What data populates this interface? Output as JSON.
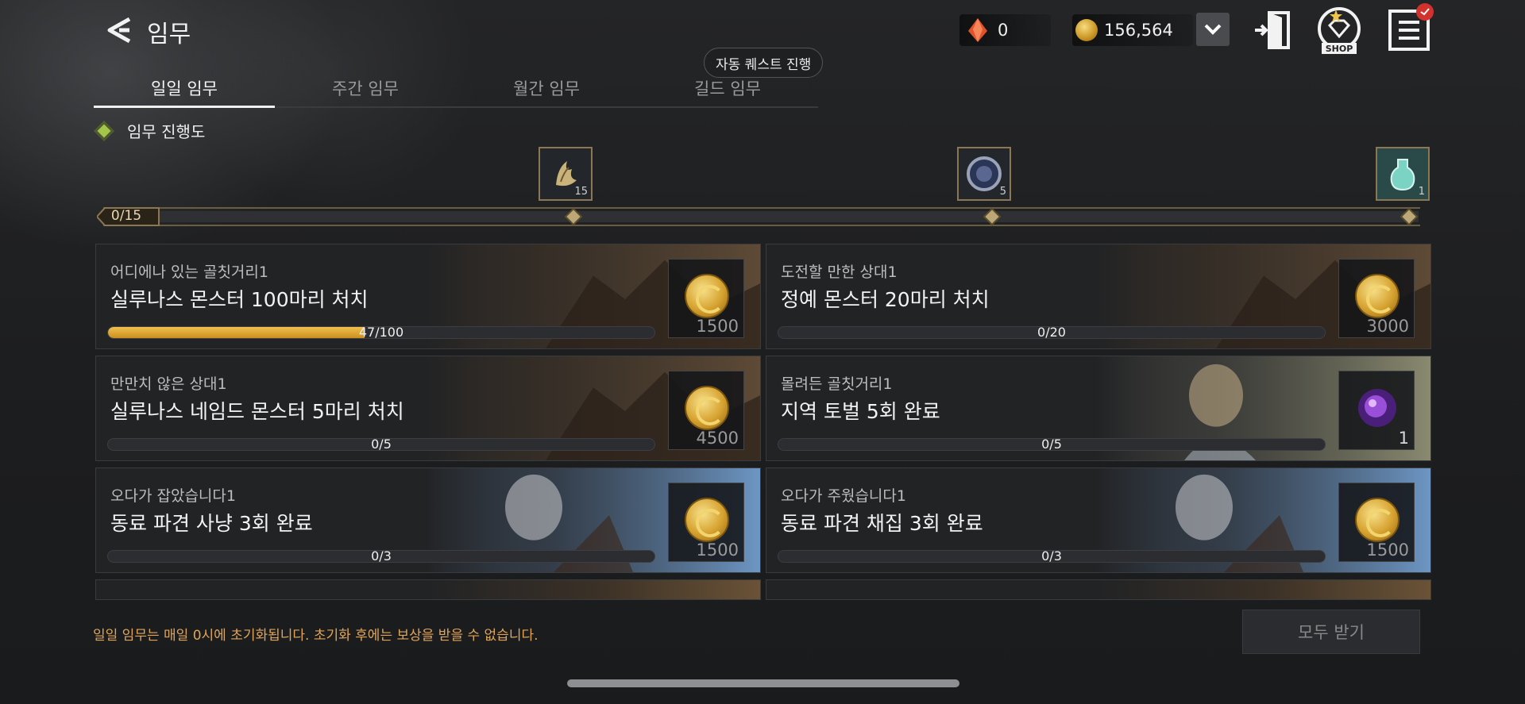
{
  "header": {
    "title": "임무",
    "back_icon": "back-arrow-icon"
  },
  "currency": {
    "gem_count": "0",
    "gold_count": "156,564",
    "gem_color": "#e4542b",
    "gold_color": "#d8a431"
  },
  "header_buttons": {
    "expand": "chevron-down-icon",
    "exit": "exit-door-icon",
    "shop_label": "SHOP",
    "menu": "hamburger-menu-icon",
    "notification_badge": "check-icon"
  },
  "auto_quest_label": "자동 퀘스트 진행",
  "tabs": [
    {
      "label": "일일 임무",
      "active": true
    },
    {
      "label": "주간 임무"
    },
    {
      "label": "월간 임무"
    },
    {
      "label": "길드 임무"
    }
  ],
  "progress": {
    "title": "임무 진행도",
    "count_text": "0/15",
    "current": 0,
    "max": 15,
    "rewards": [
      {
        "icon": "claw-item-icon",
        "qty": "15",
        "threshold": 5
      },
      {
        "icon": "medallion-item-icon",
        "qty": "5",
        "threshold": 10
      },
      {
        "icon": "potion-item-icon",
        "qty": "1",
        "threshold": 15
      }
    ]
  },
  "missions": [
    {
      "subtitle": "어디에나 있는 골칫거리1",
      "title": "실루나스 몬스터 100마리 처치",
      "progress_text": "47/100",
      "progress": 0.47,
      "reward_icon": "gold-coin-icon",
      "reward_amount": "1500"
    },
    {
      "subtitle": "도전할 만한 상대1",
      "title": "정예 몬스터 20마리 처치",
      "progress_text": "0/20",
      "progress": 0,
      "reward_icon": "gold-coin-icon",
      "reward_amount": "3000"
    },
    {
      "subtitle": "만만치 않은 상대1",
      "title": "실루나스 네임드 몬스터 5마리 처치",
      "progress_text": "0/5",
      "progress": 0,
      "reward_icon": "gold-coin-icon",
      "reward_amount": "4500"
    },
    {
      "subtitle": "몰려든 골칫거리1",
      "title": "지역 토벌 5회 완료",
      "progress_text": "0/5",
      "progress": 0,
      "reward_icon": "purple-orb-icon",
      "reward_amount": "1"
    },
    {
      "subtitle": "오다가 잡았습니다1",
      "title": "동료 파견 사냥 3회 완료",
      "progress_text": "0/3",
      "progress": 0,
      "reward_icon": "gold-coin-icon",
      "reward_amount": "1500"
    },
    {
      "subtitle": "오다가 주웠습니다1",
      "title": "동료 파견 채집 3회 완료",
      "progress_text": "0/3",
      "progress": 0,
      "reward_icon": "gold-coin-icon",
      "reward_amount": "1500"
    }
  ],
  "footer": {
    "notice": "일일 임무는 매일 0시에 초기화됩니다. 초기화 후에는 보상을 받을 수 없습니다.",
    "claim_all_label": "모두 받기"
  }
}
